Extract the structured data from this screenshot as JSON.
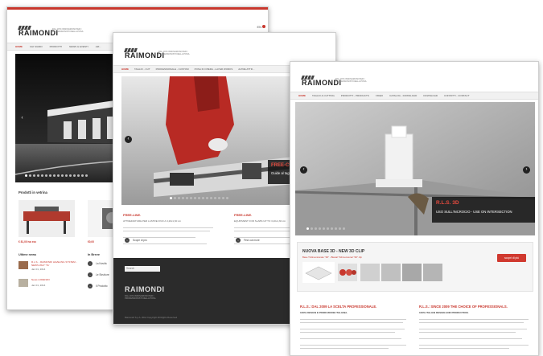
{
  "brand": {
    "logo": "RAIMONDI",
    "tagline": "DAL 1974 INNOVAZIONI PER I PROFESSIONISTI DELLA POSA"
  },
  "shot1": {
    "nav": [
      "Home",
      "Chi siamo",
      "Prodotti",
      "News & Eventi",
      "Azi..."
    ],
    "products_heading": "Prodotti in vetrina",
    "prices": [
      "€ 81,00 iva ecc",
      "€0,00",
      "€0,00"
    ],
    "news_heading": "Ultime news",
    "news": [
      {
        "title": "R.L.S. - RAIMONDI LEVELING SYSTEM - NEWS WHY 'TA'",
        "date": "Jan 01, 2014"
      },
      {
        "title": "News LORENZO",
        "date": "Jan 01, 2014"
      }
    ],
    "area_heading": "In Breve",
    "area_items": [
      "La Novità",
      "Le Strutture",
      "Il Prodotto"
    ],
    "lang": "EN"
  },
  "shot2": {
    "nav": [
      "HOME",
      "TAGLIO - CUT",
      "PROFESSIONALE - CUSTOM",
      "POSA IN OPERA - LAYER WORKS",
      "ALTRE ATTR..."
    ],
    "slide_title": "FREE-CUT",
    "slide_sub": "Guide al taglio",
    "col1_title": "FREE-LINE.",
    "col1_sub": "ATTREZZATURE PER LASTRE FINO A 3,20x1,60 cm",
    "col2_title": "FREE-LINE.",
    "col2_sub": "EQUIPMENT FOR SLABS UP TO 3,20x1,60 cm",
    "more1": "Scopri di più",
    "more2": "Find out more",
    "search": "Search",
    "footer_copy": "Raimondi S.p.A. 2014 Copyright All Rights Reserved"
  },
  "shot3": {
    "nav": [
      "HOME",
      "TAGLIO & CUTTING",
      "PRODOTTI - PRODUCTS",
      "VIDEO",
      "CATALOG - DOWNLOAD",
      "DOWNLOAD",
      "CONTATTI - CONTACT"
    ],
    "slide_title": "R.L.S. 3D",
    "slide_sub": "USO SULL'INCROCIO - USE ON INTERSECTION",
    "promo_title": "NUOVA BASE 3D - NEW 3D CLIP",
    "promo_sub": "Base Tridimensionale \"3D\" - Biaxial Tridimensional \"3D\" clip",
    "promo_button": "scopri di più",
    "left_title": "R.L.S.: DAL 2009 LA SCELTA PROFESSIONALE.",
    "left_sub": "100% DESIGN E PRODUZIONE ITALIANA.",
    "right_title": "R.L.S.: SINCE 2009 THE CHOICE OF PROFESSIONALS.",
    "right_sub": "100% ITALIAN DESIGN AND PRODUCTION."
  },
  "colors": {
    "accent": "#c8372d",
    "dark_footer": "#2b2b2b",
    "nav_bg": "#f1f1f1"
  }
}
